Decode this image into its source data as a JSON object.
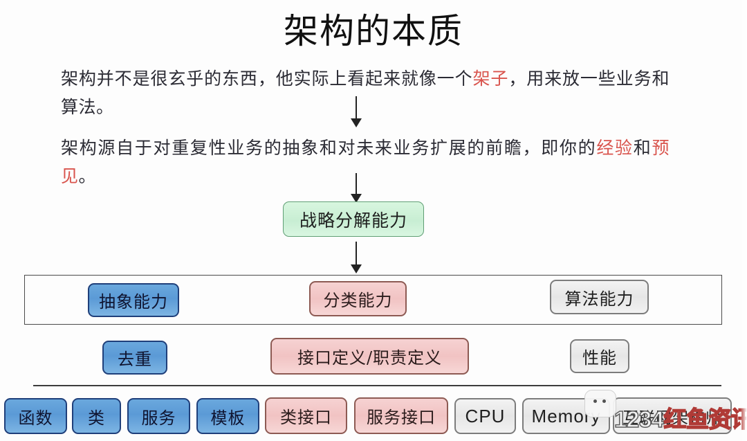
{
  "slide": {
    "title": "架构的本质",
    "paragraphs": [
      {
        "id": "p1",
        "segments": [
          {
            "text": "架构并不是很玄乎的东西，他实际上看起来就像一个",
            "highlight": false
          },
          {
            "text": "架子",
            "highlight": true
          },
          {
            "text": "，用来放一些业务和算法。",
            "highlight": false
          }
        ]
      },
      {
        "id": "p2",
        "segments": [
          {
            "text": "架构源自于对重复性业务的抽象和对未来业务扩展的前瞻，即你的",
            "highlight": false
          },
          {
            "text": "经验",
            "highlight": true
          },
          {
            "text": "和",
            "highlight": false
          },
          {
            "text": "预见",
            "highlight": true
          },
          {
            "text": "。",
            "highlight": false
          }
        ]
      }
    ],
    "key_box": {
      "label": "战略分解能力",
      "color": "#c8eed3"
    },
    "capability_row": {
      "items": [
        {
          "label": "抽象能力",
          "style": "blue",
          "color": "#5b9ad6"
        },
        {
          "label": "分类能力",
          "style": "pink",
          "color": "#f1c3c3"
        },
        {
          "label": "算法能力",
          "style": "gray",
          "color": "#e6e6e6"
        }
      ]
    },
    "detail_row": {
      "items": [
        {
          "label": "去重",
          "style": "blue",
          "color": "#5b9ad6"
        },
        {
          "label": "接口定义/职责定义",
          "style": "pink",
          "color": "#f1c3c3"
        },
        {
          "label": "性能",
          "style": "gray",
          "color": "#e6e6e6"
        }
      ]
    },
    "implementation_row": {
      "items": [
        {
          "label": "函数",
          "style": "blue",
          "color": "#5b9ad6"
        },
        {
          "label": "类",
          "style": "blue",
          "color": "#5b9ad6"
        },
        {
          "label": "服务",
          "style": "blue",
          "color": "#5b9ad6"
        },
        {
          "label": "模板",
          "style": "blue",
          "color": "#5b9ad6"
        },
        {
          "label": "类接口",
          "style": "pink",
          "color": "#f1c3c3"
        },
        {
          "label": "服务接口",
          "style": "pink",
          "color": "#f1c3c3"
        },
        {
          "label": "CPU",
          "style": "gray",
          "color": "#e6e6e6"
        },
        {
          "label": "Memory",
          "style": "gray",
          "color": "#e6e6e6"
        },
        {
          "label": "互联网架构师",
          "style": "gray",
          "color": "#e6e6e6"
        }
      ]
    },
    "arrows": [
      {
        "name": "arrow-intro-to-source"
      },
      {
        "name": "arrow-source-to-strategy"
      },
      {
        "name": "arrow-strategy-to-capabilities"
      }
    ],
    "watermark": {
      "number_part": "1234",
      "text_part": "红鱼资讯网"
    },
    "colors": {
      "highlight": "#d9544d",
      "blue": "#5b9ad6",
      "pink": "#f1c3c3",
      "gray": "#e6e6e6",
      "green": "#c8eed3",
      "outline": "#4a4a4a"
    }
  }
}
